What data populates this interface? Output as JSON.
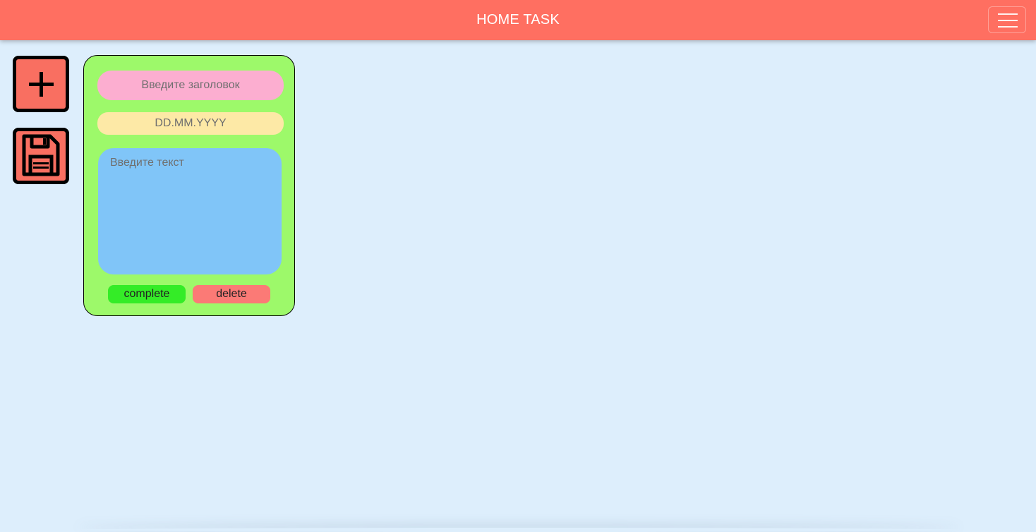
{
  "header": {
    "title": "HOME TASK",
    "menu_icon": "hamburger-menu-icon"
  },
  "toolbar": {
    "add_icon": "plus-icon",
    "save_icon": "floppy-disk-icon"
  },
  "note_card": {
    "title_placeholder": "Введите заголовок",
    "date_placeholder": "DD.MM.YYYY",
    "text_placeholder": "Введите текст",
    "complete_label": "complete",
    "delete_label": "delete"
  },
  "colors": {
    "header_bg": "#ff6f61",
    "page_bg": "#ddeefc",
    "card_bg": "#9df96a",
    "title_field_bg": "#fcaed0",
    "date_field_bg": "#fde9a6",
    "text_field_bg": "#80c5f8",
    "complete_bg": "#34ec27",
    "delete_bg": "#fb7a76",
    "tool_button_bg": "#f96f61"
  }
}
